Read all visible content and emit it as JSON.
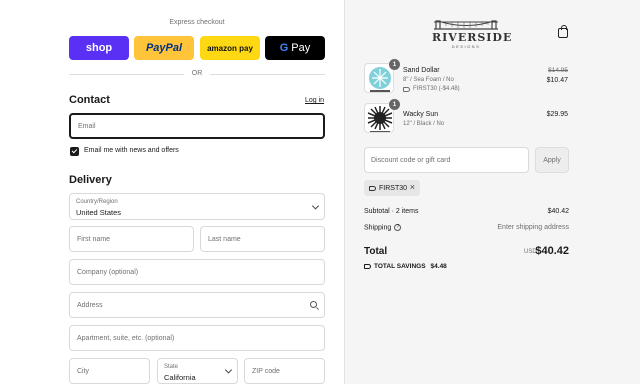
{
  "express": {
    "title": "Express checkout",
    "shop": "shop",
    "paypal": "PayPal",
    "amazon": "amazon pay",
    "gpay_g": "G",
    "gpay": "Pay",
    "or": "OR"
  },
  "contact": {
    "heading": "Contact",
    "login": "Log in",
    "email_placeholder": "Email",
    "newsletter_label": "Email me with news and offers",
    "newsletter_checked": true
  },
  "delivery": {
    "heading": "Delivery",
    "country_label": "Country/Region",
    "country_value": "United States",
    "first_name": "First name",
    "last_name": "Last name",
    "company": "Company (optional)",
    "address": "Address",
    "apartment": "Apartment, suite, etc. (optional)",
    "city": "City",
    "state_label": "State",
    "state_value": "California",
    "zip": "ZIP code"
  },
  "brand": {
    "name": "RIVERSIDE",
    "sub": "DESIGNS"
  },
  "cart": {
    "items": [
      {
        "qty": "1",
        "name": "Sand Dollar",
        "variant": "8\" / Sea Foam / No",
        "discount": "FIRST30 (-$4.48)",
        "price_old": "$14.95",
        "price": "$10.47"
      },
      {
        "qty": "1",
        "name": "Wacky Sun",
        "variant": "12\" / Black / No",
        "discount": "",
        "price_old": "",
        "price": "$29.95"
      }
    ]
  },
  "discount": {
    "placeholder": "Discount code or gift card",
    "apply": "Apply",
    "code": "FIRST30",
    "remove": "×"
  },
  "summary": {
    "subtotal_label": "Subtotal · 2 items",
    "subtotal": "$40.42",
    "shipping_label": "Shipping",
    "shipping_help": "?",
    "shipping_value": "Enter shipping address",
    "total_label": "Total",
    "currency": "USD",
    "total": "$40.42",
    "savings_label": "TOTAL SAVINGS",
    "savings": "$4.48"
  },
  "colors": {
    "shop": "#5a31f4",
    "paypal": "#ffc439",
    "amazon": "#ffd814",
    "gpay": "#000000",
    "sidebar_bg": "#f5f5f5"
  }
}
